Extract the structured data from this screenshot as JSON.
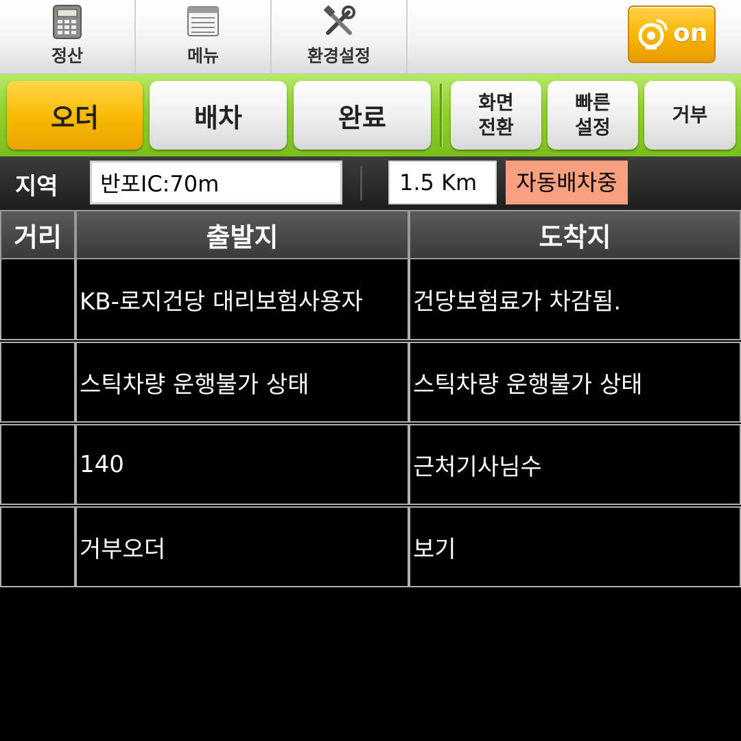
{
  "toolbar": {
    "items": [
      {
        "label": "정산",
        "icon": "calculator-icon"
      },
      {
        "label": "메뉴",
        "icon": "list-icon"
      },
      {
        "label": "환경설정",
        "icon": "tools-icon"
      }
    ],
    "toggle": {
      "label": "on",
      "icon": "satellite-icon"
    }
  },
  "tabs": {
    "main": [
      "오더",
      "배차",
      "완료"
    ],
    "side": [
      {
        "line1": "화면",
        "line2": "전환"
      },
      {
        "line1": "빠른",
        "line2": "설정"
      },
      {
        "line1": "거부",
        "line2": ""
      }
    ]
  },
  "region": {
    "label": "지역",
    "value": "반포IC:70m",
    "distance": "1.5 Km",
    "status": "자동배차중"
  },
  "table": {
    "headers": [
      "거리",
      "출발지",
      "도착지"
    ],
    "rows": [
      {
        "distance": "",
        "origin": "KB-로지건당 대리보험사용자",
        "destination": "건당보험료가 차감됨."
      },
      {
        "distance": "",
        "origin": "스틱차량 운행불가 상태",
        "destination": "스틱차량 운행불가 상태"
      },
      {
        "distance": "",
        "origin": "140",
        "destination": "근처기사님수"
      },
      {
        "distance": "",
        "origin": "거부오더",
        "destination": "보기"
      }
    ]
  },
  "colors": {
    "accent_orange": "#f7b300",
    "tabbar_green": "#8ed12a",
    "status_bg": "#f9a07f"
  }
}
